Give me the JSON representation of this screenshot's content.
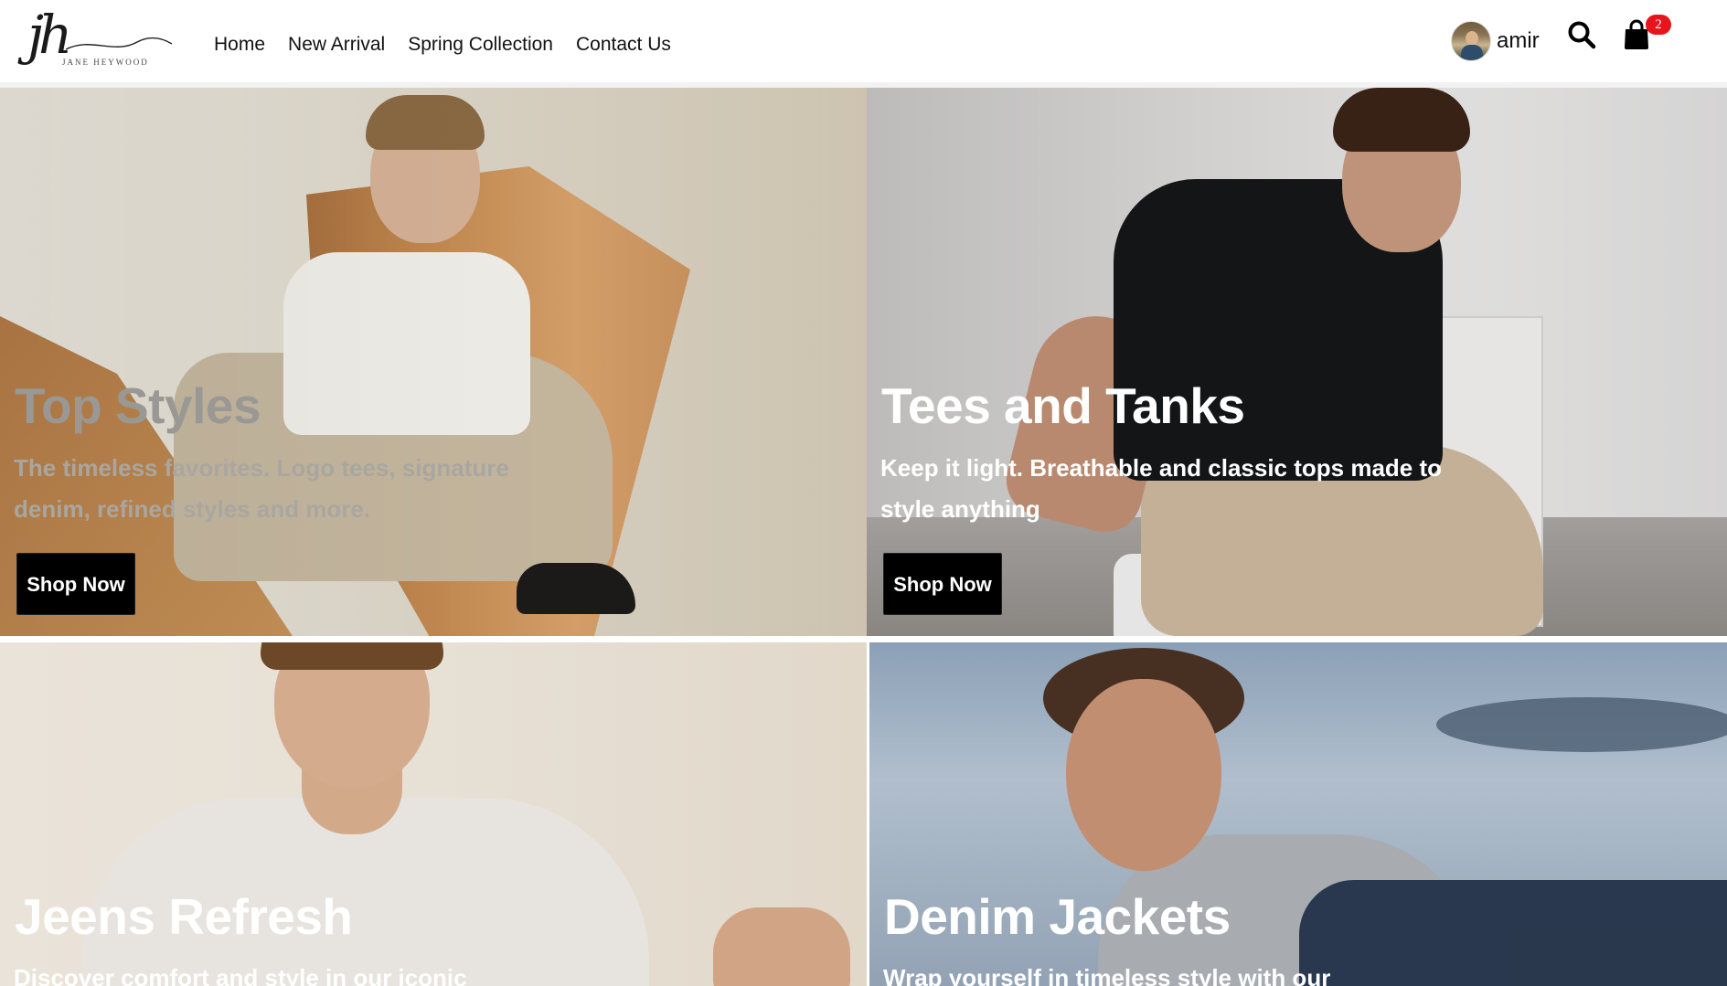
{
  "brand": {
    "mark": "jh",
    "name": "JANE HEYWOOD"
  },
  "nav": {
    "items": [
      {
        "label": "Home"
      },
      {
        "label": "New Arrival"
      },
      {
        "label": "Spring Collection"
      },
      {
        "label": "Contact Us"
      }
    ]
  },
  "user": {
    "name": "amir"
  },
  "cart": {
    "count": "2"
  },
  "icons": {
    "search": "search-icon",
    "cart": "shopping-bag-icon"
  },
  "colors": {
    "badge": "#e8141b",
    "button": "#000000"
  },
  "tiles": [
    {
      "title": "Top Styles",
      "text": "The timeless favorites. Logo tees, signature denim, refined styles and more.",
      "button": "Shop Now"
    },
    {
      "title": "Tees and Tanks",
      "text": "Keep it light. Breathable and classic tops made to style anything",
      "button": "Shop Now"
    },
    {
      "title": "Jeens Refresh",
      "text": "Discover comfort and style in our iconic"
    },
    {
      "title": "Denim Jackets",
      "text": "Wrap yourself in timeless style with our"
    }
  ]
}
